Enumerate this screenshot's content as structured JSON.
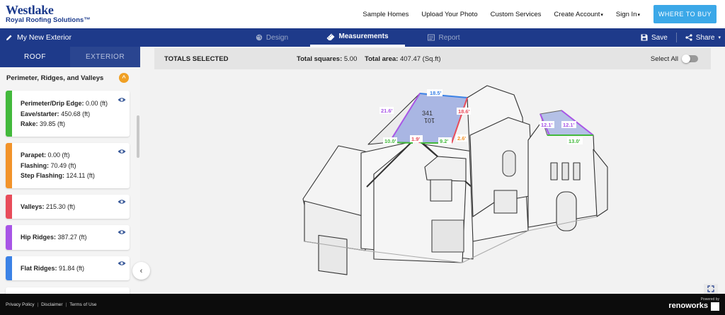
{
  "brand": {
    "logo_main": "Westlake",
    "logo_sub": "Royal Roofing Solutions™"
  },
  "nav": {
    "links": [
      "Sample Homes",
      "Upload Your Photo",
      "Custom Services",
      "Create Account",
      "Sign In"
    ],
    "cta": "WHERE TO BUY"
  },
  "toolbar": {
    "project_name": "My New Exterior",
    "tabs": [
      "Design",
      "Measurements",
      "Report"
    ],
    "active_tab": "Measurements",
    "save": "Save",
    "share": "Share"
  },
  "sidebar": {
    "tabs": [
      "ROOF",
      "EXTERIOR"
    ],
    "section_title": "Perimeter, Ridges, and Valleys",
    "cards": [
      {
        "color": "#43b93c",
        "lines": [
          {
            "label": "Perimeter/Drip Edge:",
            "value": "0.00 (ft)"
          },
          {
            "label": "Eave/starter:",
            "value": "450.68 (ft)"
          },
          {
            "label": "Rake:",
            "value": "39.85 (ft)"
          }
        ]
      },
      {
        "color": "#f2932a",
        "lines": [
          {
            "label": "Parapet:",
            "value": "0.00 (ft)"
          },
          {
            "label": "Flashing:",
            "value": "70.49 (ft)"
          },
          {
            "label": "Step Flashing:",
            "value": "124.11 (ft)"
          }
        ]
      },
      {
        "color": "#e84c5a",
        "lines": [
          {
            "label": "Valleys:",
            "value": "215.30 (ft)"
          }
        ]
      },
      {
        "color": "#a855e6",
        "lines": [
          {
            "label": "Hip Ridges:",
            "value": "387.27 (ft)"
          }
        ]
      },
      {
        "color": "#3b82e6",
        "lines": [
          {
            "label": "Flat Ridges:",
            "value": "91.84 (ft)"
          }
        ]
      }
    ]
  },
  "totals": {
    "label": "TOTALS SELECTED",
    "squares_label": "Total squares:",
    "squares_value": "5.00",
    "area_label": "Total area:",
    "area_value": "407.47 (Sq.ft)",
    "select_all": "Select All"
  },
  "measurements": {
    "top_edge": "18.5'",
    "left_rake": "21.6'",
    "right_valley": "18.6'",
    "bottom_left": "10.0'",
    "bottom_mid": "1.9'",
    "bottom_right": "9.2'",
    "bottom_orange": "2.6'",
    "right_hip_left": "12.1'",
    "right_hip_right": "12.1'",
    "right_bottom": "13.0'",
    "area_top": "341",
    "area_bottom": "101"
  },
  "footer": {
    "links": [
      "Privacy Policy",
      "Disclaimer",
      "Terms of Use"
    ],
    "powered_by": "Powered by",
    "powered_brand": "renoworks"
  }
}
